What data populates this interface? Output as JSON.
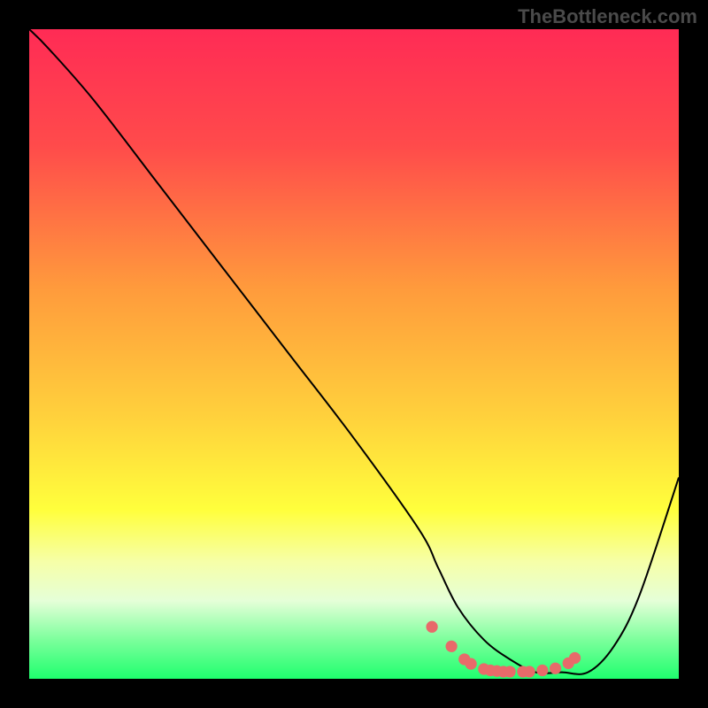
{
  "watermark": "TheBottleneck.com",
  "chart_data": {
    "type": "line",
    "title": "",
    "xlabel": "",
    "ylabel": "",
    "xlim": [
      0,
      100
    ],
    "ylim": [
      0,
      100
    ],
    "gradient_stops": [
      {
        "offset": 0,
        "color": "#ff2b55"
      },
      {
        "offset": 18,
        "color": "#ff4b4b"
      },
      {
        "offset": 40,
        "color": "#ff9b3c"
      },
      {
        "offset": 60,
        "color": "#ffd23c"
      },
      {
        "offset": 74,
        "color": "#ffff3c"
      },
      {
        "offset": 82,
        "color": "#f6ffa8"
      },
      {
        "offset": 88,
        "color": "#e5ffd8"
      },
      {
        "offset": 94,
        "color": "#7cff9c"
      },
      {
        "offset": 100,
        "color": "#1fff6e"
      }
    ],
    "series": [
      {
        "name": "bottleneck-curve",
        "x": [
          0,
          3,
          10,
          20,
          30,
          40,
          50,
          60,
          63,
          66,
          70,
          74,
          78,
          82,
          86,
          90,
          94,
          100
        ],
        "y": [
          100,
          97,
          89,
          76,
          63,
          50,
          37,
          23,
          17,
          11,
          6,
          3,
          1,
          1,
          1,
          5,
          13,
          31
        ]
      }
    ],
    "markers": {
      "name": "valley-dots",
      "color": "#e86a6a",
      "x": [
        62,
        65,
        67,
        68,
        70,
        71,
        72,
        73,
        74,
        76,
        77,
        79,
        81,
        83,
        84
      ],
      "y": [
        8,
        5,
        3,
        2.3,
        1.5,
        1.3,
        1.2,
        1.1,
        1.1,
        1.1,
        1.1,
        1.3,
        1.6,
        2.4,
        3.2
      ]
    }
  }
}
